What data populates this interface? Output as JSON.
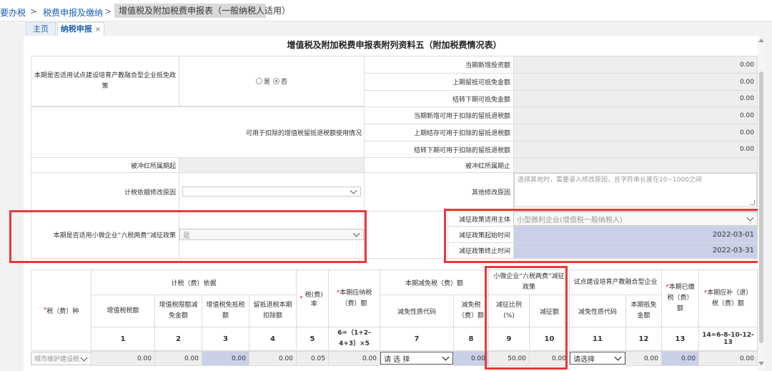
{
  "breadcrumb": {
    "item1": "要办税",
    "sep": ">",
    "item2": "税费申报及缴纳",
    "item3": "增值税及附加税费申报表（一般纳税人适用）"
  },
  "tabs": [
    {
      "label": "主页"
    },
    {
      "label": "纳税申报",
      "close": "×"
    }
  ],
  "form": {
    "title": "增值税及附加税费申报表附列资料五（附加税费情况表）",
    "pilot_label": "本期是否适用试点建设培育产教融合型企业抵免政策",
    "radio_yes": "是",
    "radio_no": "否",
    "new_invest_label": "当期新增投资额",
    "new_invest_val": "0.00",
    "prev_credit_label": "上期留抵可抵免金额",
    "prev_credit_val": "0.00",
    "next_credit_label": "结转下期可抵免金额",
    "next_credit_val": "0.00",
    "refund_use_label": "可用于扣除的增值税留抵退税额使用情况",
    "cur_new_label": "当期新增可用于扣除的留抵退税额",
    "cur_new_val": "0.00",
    "prev_carry_label": "上期结存可用于扣除的留抵退税额",
    "prev_carry_val": "0.00",
    "next_carry_label": "结转下期可用于扣除的留抵退税额",
    "next_carry_val": "0.00",
    "red_start_label": "被冲红所属期起",
    "red_end_label": "被冲红所属期止",
    "basis_reason_label": "计税依据修改原因",
    "other_reason_label": "其他修改原因",
    "other_reason_placeholder": "选择其他时，需要录入修改原因，且字符串长度在10~1000之间",
    "six_tax_label": "本期是否适用小微企业“六税两费”减征政策",
    "six_tax_val": "是",
    "subject_label": "减征政策适用主体",
    "subject_val": "小型微利企业(增值税一般纳税人)",
    "start_label": "减征政策起始时间",
    "start_val": "2022-03-01",
    "end_label": "减征政策终止时间",
    "end_val": "2022-03-31"
  },
  "table": {
    "h_tax": "税（费）种",
    "h_basis": "计税（费）依据",
    "h_vat": "增值税税额",
    "h_vat_exempt": "增值税限额减免金额",
    "h_vat_credit": "增值税免抵税额",
    "h_refund": "留抵退税本期扣除额",
    "h_rate": "税(费)率",
    "h_payable": "本期应纳税（费）额",
    "h_reduce": "本期减免税（费）额",
    "h_code": "减免性质代码",
    "h_reduce_amt": "减免税（费）额",
    "h_small": "小微企业“六税两费”减征政策",
    "h_ratio": "减征比例(%)",
    "h_amt": "减征额",
    "h_pilot": "试点建设培育产教融合型企业",
    "h_pilot_code": "减免性质代码",
    "h_pilot_amt": "本期抵免金额",
    "h_paid": "本期已缴税（费）额",
    "h_supp": "本期应补（退）税（费）额",
    "n1": "1",
    "n2": "2",
    "n3": "3",
    "n4": "4",
    "n5": "5",
    "n6": "6=（1+2-4+3）×5",
    "n7": "7",
    "n8": "8",
    "n9": "9",
    "n10": "10",
    "n11": "11",
    "n12": "12",
    "n13": "13",
    "n14": "14=6-8-10-12-13",
    "row": {
      "tax": "城市维护建设税",
      "v1": "0.00",
      "v2": "0.00",
      "v3": "0.00",
      "v4": "0.00",
      "v5": "0.05",
      "v6": "0.00",
      "sel7": "请 选 择",
      "v8": "0.00",
      "v9": "50.00",
      "v10": "0.00",
      "sel11": "请选择",
      "v12": "0.00",
      "v13": "0.00",
      "v14": "0.00"
    }
  }
}
